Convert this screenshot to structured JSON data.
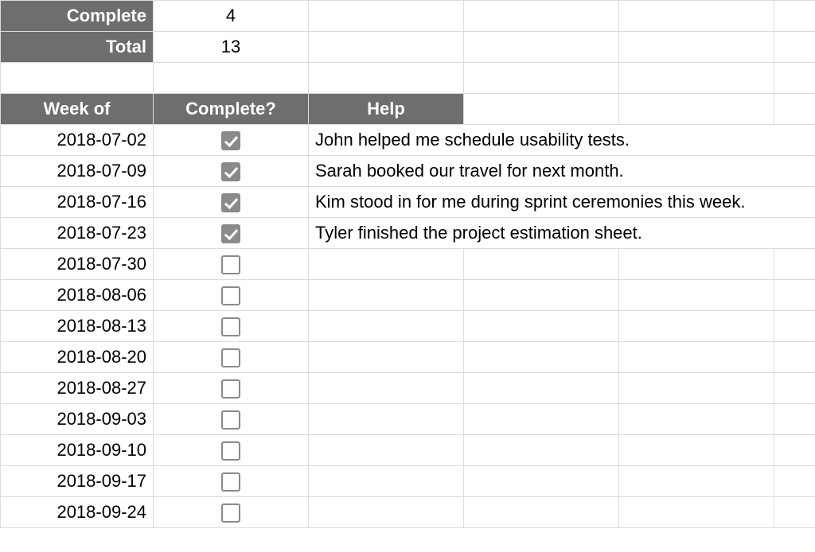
{
  "summary": {
    "complete_label": "Complete",
    "complete_value": "4",
    "total_label": "Total",
    "total_value": "13"
  },
  "headers": {
    "week": "Week of",
    "complete": "Complete?",
    "help": "Help"
  },
  "rows": [
    {
      "week": "2018-07-02",
      "checked": true,
      "help": "John helped me schedule usability tests."
    },
    {
      "week": "2018-07-09",
      "checked": true,
      "help": "Sarah booked our travel for next month."
    },
    {
      "week": "2018-07-16",
      "checked": true,
      "help": "Kim stood in for me during sprint ceremonies this week."
    },
    {
      "week": "2018-07-23",
      "checked": true,
      "help": "Tyler finished the project estimation sheet."
    },
    {
      "week": "2018-07-30",
      "checked": false,
      "help": ""
    },
    {
      "week": "2018-08-06",
      "checked": false,
      "help": ""
    },
    {
      "week": "2018-08-13",
      "checked": false,
      "help": ""
    },
    {
      "week": "2018-08-20",
      "checked": false,
      "help": ""
    },
    {
      "week": "2018-08-27",
      "checked": false,
      "help": ""
    },
    {
      "week": "2018-09-03",
      "checked": false,
      "help": ""
    },
    {
      "week": "2018-09-10",
      "checked": false,
      "help": ""
    },
    {
      "week": "2018-09-17",
      "checked": false,
      "help": ""
    },
    {
      "week": "2018-09-24",
      "checked": false,
      "help": ""
    }
  ]
}
